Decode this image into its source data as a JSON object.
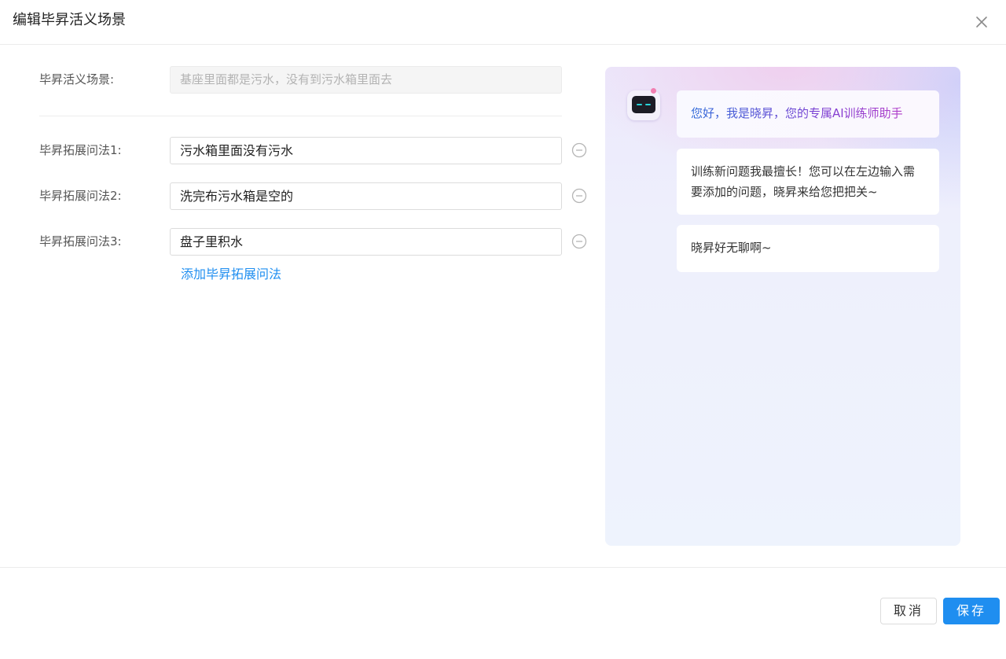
{
  "dialog": {
    "title": "编辑毕昇活义场景"
  },
  "form": {
    "scene_label": "毕昇活义场景:",
    "scene_value": "基座里面都是污水，没有到污水箱里面去",
    "variants": [
      {
        "label": "毕昇拓展问法1:",
        "value": "污水箱里面没有污水"
      },
      {
        "label": "毕昇拓展问法2:",
        "value": "洗完布污水箱是空的"
      },
      {
        "label": "毕昇拓展问法3:",
        "value": "盘子里积水"
      }
    ],
    "add_link": "添加毕昇拓展问法"
  },
  "chat": {
    "messages": [
      "您好，我是晓昇，您的专属AI训练师助手",
      "训练新问题我最擅长！您可以在左边输入需要添加的问题，晓昇来给您把把关~",
      "晓昇好无聊啊~"
    ]
  },
  "footer": {
    "cancel_label": "取消",
    "save_label": "保存"
  },
  "colors": {
    "primary": "#1f8ef0",
    "disabled_bg": "#f5f5f5",
    "panel_bg": "#eef1fc"
  }
}
